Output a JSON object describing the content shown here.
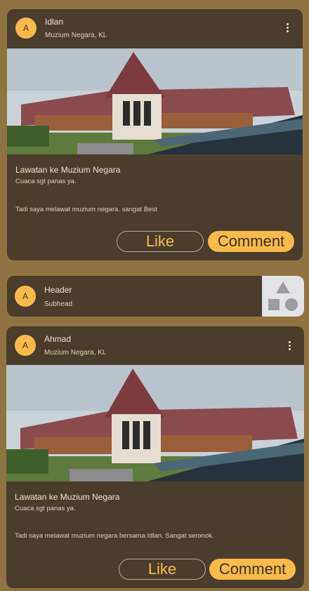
{
  "posts": [
    {
      "avatar": "A",
      "name": "Idlan",
      "location": "Muzium Negara, KL",
      "title": "Lawatan ke Muzium Negara",
      "subtitle": "Cuaca sgt panas ya.",
      "body": "Tadi saya melawat muzium negara. sangat Best",
      "like_label": "Like",
      "comment_label": "Comment"
    },
    {
      "avatar": "A",
      "name": "Ahmad",
      "location": "Muzium Negara, KL",
      "title": "Lawatan ke Muzium Negara",
      "subtitle": "Cuaca sgt panas ya.",
      "body": "Tadi saya melawat muzium negara bersama Idlan. Sangat seronok.",
      "like_label": "Like",
      "comment_label": "Comment"
    }
  ],
  "list_item": {
    "avatar": "A",
    "header": "Header",
    "subhead": "Subhead"
  },
  "colors": {
    "background": "#8f7442",
    "card": "#4a3d2d",
    "accent": "#f8bb4b"
  },
  "icons": {
    "more": "more-vert-icon",
    "placeholder": "shapes-placeholder-icon"
  }
}
